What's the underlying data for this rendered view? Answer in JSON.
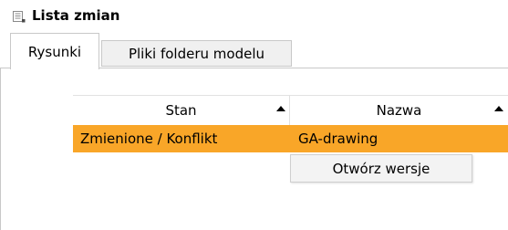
{
  "window": {
    "title": "Lista zmian",
    "icon": "list-icon"
  },
  "tabs": [
    {
      "label": "Rysunki",
      "active": true
    },
    {
      "label": "Pliki folderu modelu",
      "active": false
    }
  ],
  "grid": {
    "columns": [
      {
        "label": "Stan",
        "sort": "ascending"
      },
      {
        "label": "Nazwa",
        "sort": "ascending"
      }
    ],
    "rows": [
      {
        "stan": "Zmienione / Konflikt",
        "nazwa": "GA-drawing",
        "selected": true
      }
    ],
    "selection_color": "#f9a628"
  },
  "context_menu": {
    "items": [
      {
        "label": "Otwórz wersje"
      }
    ]
  }
}
